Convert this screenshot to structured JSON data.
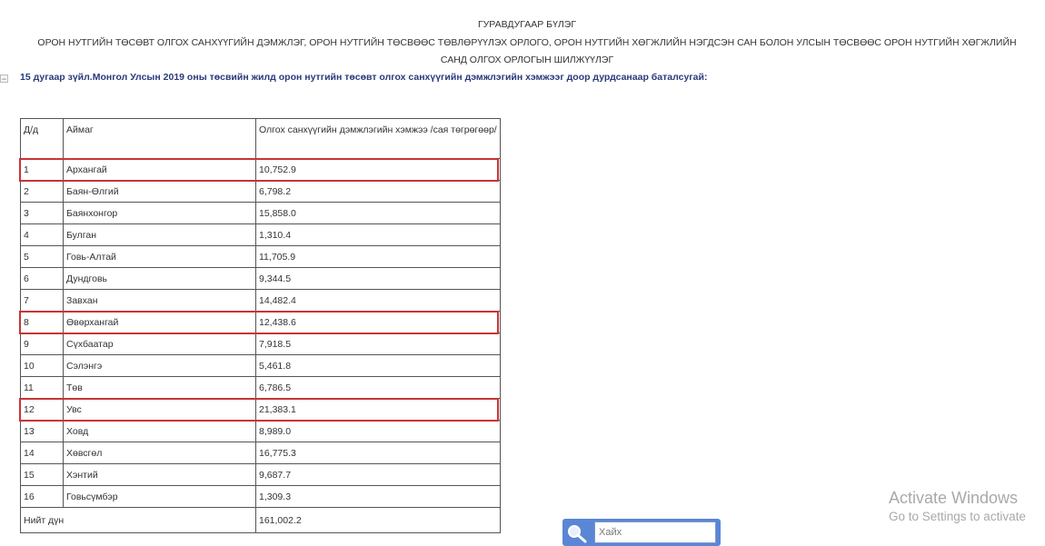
{
  "header": {
    "chapter": "ГУРАВДУГААР БҮЛЭГ",
    "subtitle_line1": "ОРОН НУТГИЙН ТӨСӨВТ ОЛГОХ САНХҮҮГИЙН ДЭМЖЛЭГ, ОРОН НУТГИЙН ТӨСВӨӨС ТӨВЛӨРҮҮЛЭХ ОРЛОГО, ОРОН НУТГИЙН ХӨГЖЛИЙН НЭГДСЭН САН БОЛОН УЛСЫН ТӨСВӨӨС ОРОН НУТГИЙН ХӨГЖЛИЙН",
    "subtitle_line2": "САНД ОЛГОХ ОРЛОГЫН ШИЛЖҮҮЛЭГ"
  },
  "article": {
    "toggle": "−",
    "text": "15 дугаар зүйл.Монгол Улсын 2019 оны төсвийн жилд орон нутгийн төсөвт олгох санхүүгийн дэмжлэгийн хэмжээг доор дурдсанаар баталсугай:"
  },
  "table": {
    "headers": [
      "Д/д",
      "Аймаг",
      "Олгох санхүүгийн дэмжлэгийн хэмжээ /сая төгрөгөөр/"
    ],
    "rows": [
      [
        "1",
        "Архангай",
        "10,752.9"
      ],
      [
        "2",
        "Баян-Өлгий",
        "6,798.2"
      ],
      [
        "3",
        "Баянхонгор",
        "15,858.0"
      ],
      [
        "4",
        "Булган",
        "1,310.4"
      ],
      [
        "5",
        "Говь-Алтай",
        "11,705.9"
      ],
      [
        "6",
        "Дундговь",
        "9,344.5"
      ],
      [
        "7",
        "Завхан",
        "14,482.4"
      ],
      [
        "8",
        "Өвөрхангай",
        "12,438.6"
      ],
      [
        "9",
        "Сүхбаатар",
        "7,918.5"
      ],
      [
        "10",
        "Сэлэнгэ",
        "5,461.8"
      ],
      [
        "11",
        "Төв",
        "6,786.5"
      ],
      [
        "12",
        "Увс",
        "21,383.1"
      ],
      [
        "13",
        "Ховд",
        "8,989.0"
      ],
      [
        "14",
        "Хөвсгөл",
        "16,775.3"
      ],
      [
        "15",
        "Хэнтий",
        "9,687.7"
      ],
      [
        "16",
        "Говьсүмбэр",
        "1,309.3"
      ]
    ],
    "total": {
      "label": "Нийт дүн",
      "value": "161,002.2"
    },
    "highlighted_rows": [
      "1",
      "8",
      "12"
    ],
    "highlight_color": "#c93434"
  },
  "search": {
    "placeholder": "Хайх",
    "icon": "magnifier-icon"
  },
  "watermark": {
    "line1": "Activate Windows",
    "line2": "Go to Settings to activate"
  }
}
